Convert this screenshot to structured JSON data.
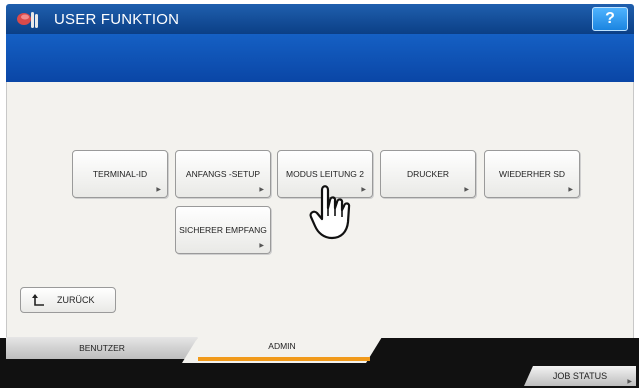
{
  "header": {
    "title": "USER FUNKTION",
    "help_label": "?",
    "icon": "user-function-icon"
  },
  "buttons": {
    "terminal_id": "TERMINAL-ID",
    "anfangs_setup": "ANFANGS -SETUP",
    "modus_leitung_2": "MODUS LEITUNG 2",
    "drucker": "DRUCKER",
    "wiederher_sd": "WIEDERHER SD",
    "sicherer_empfang": "SICHERER EMPFANG"
  },
  "back": {
    "label": "ZURÜCK",
    "icon": "back-arrow-icon"
  },
  "tabs": {
    "benutzer": "BENUTZER",
    "admin": "ADMIN"
  },
  "footer": {
    "job_status": "JOB STATUS"
  },
  "colors": {
    "header_blue": "#0b3f86",
    "accent_orange": "#f19a1a"
  }
}
